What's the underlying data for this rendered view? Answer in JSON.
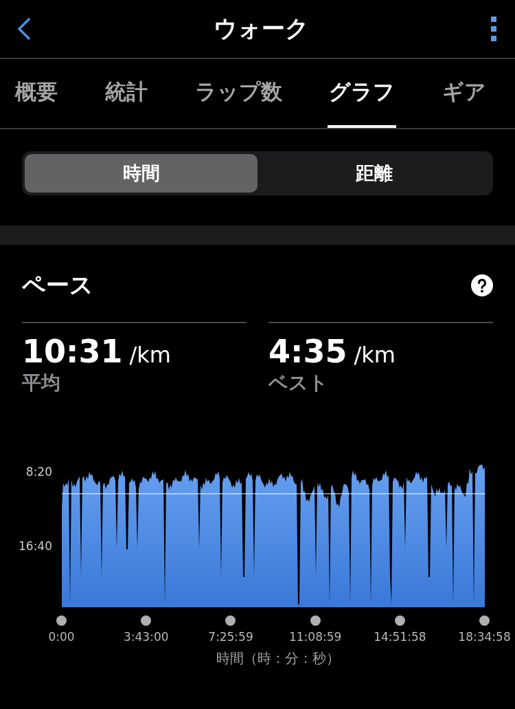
{
  "header": {
    "title": "ウォーク"
  },
  "tabs": [
    {
      "label": "概要",
      "selected": false
    },
    {
      "label": "統計",
      "selected": false
    },
    {
      "label": "ラップ数",
      "selected": false
    },
    {
      "label": "グラフ",
      "selected": true
    },
    {
      "label": "ギア",
      "selected": false
    }
  ],
  "segments": [
    {
      "label": "時間",
      "selected": true
    },
    {
      "label": "距離",
      "selected": false
    }
  ],
  "section": {
    "title": "ペース"
  },
  "stats": [
    {
      "value": "10:31",
      "unit": "/km",
      "label": "平均"
    },
    {
      "value": "4:35",
      "unit": "/km",
      "label": "ベスト"
    }
  ],
  "chart": {
    "y_ticks": [
      "8:20",
      "16:40"
    ],
    "x_ticks": [
      "0:00",
      "3:43:00",
      "7:25:59",
      "11:08:59",
      "14:51:58",
      "18:34:58"
    ],
    "x_axis_label": "時間（時：分：秒）"
  }
}
